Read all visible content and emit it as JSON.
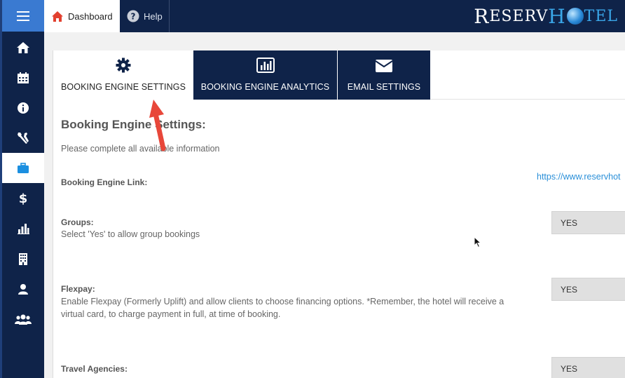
{
  "sidebar": {
    "menu_icon": "hamburger-menu-icon",
    "items": [
      {
        "icon": "home-icon"
      },
      {
        "icon": "calendar-icon"
      },
      {
        "icon": "info-icon"
      },
      {
        "icon": "tools-icon"
      },
      {
        "icon": "briefcase-icon",
        "active": true
      },
      {
        "icon": "dollar-icon"
      },
      {
        "icon": "bar-chart-icon"
      },
      {
        "icon": "building-icon"
      },
      {
        "icon": "user-icon"
      },
      {
        "icon": "users-icon"
      }
    ]
  },
  "topbar": {
    "tabs": [
      {
        "label": "Dashboard",
        "icon": "home-icon"
      },
      {
        "label": "Help",
        "icon": "question-icon"
      }
    ],
    "logo": {
      "part1_big": "R",
      "part1_small": "ESERV",
      "part2_big": "H",
      "part2_small": "TEL"
    }
  },
  "settings_tabs": [
    {
      "label": "BOOKING ENGINE SETTINGS",
      "icon": "gear-icon",
      "active": true
    },
    {
      "label": "BOOKING ENGINE ANALYTICS",
      "icon": "analytics-icon"
    },
    {
      "label": "EMAIL SETTINGS",
      "icon": "envelope-icon"
    }
  ],
  "main": {
    "heading": "Booking Engine Settings:",
    "subtext": "Please complete all available information",
    "link_label": "Booking Engine Link:",
    "link_url": "https://www.reservhot",
    "fields": [
      {
        "label": "Groups:",
        "desc": "Select 'Yes' to allow group bookings",
        "value": "YES"
      },
      {
        "label": "Flexpay:",
        "desc": "Enable Flexpay (Formerly Uplift) and allow clients to choose financing options. *Remember, the hotel will receive a virtual card, to charge payment in full, at time of booking.",
        "value": "YES"
      },
      {
        "label": "Travel Agencies:",
        "desc": "",
        "value": "YES"
      }
    ]
  },
  "colors": {
    "navy": "#0f2349",
    "accent_blue": "#3a7ad1",
    "link_blue": "#2a8fd8",
    "annotation_red": "#e8473a"
  }
}
